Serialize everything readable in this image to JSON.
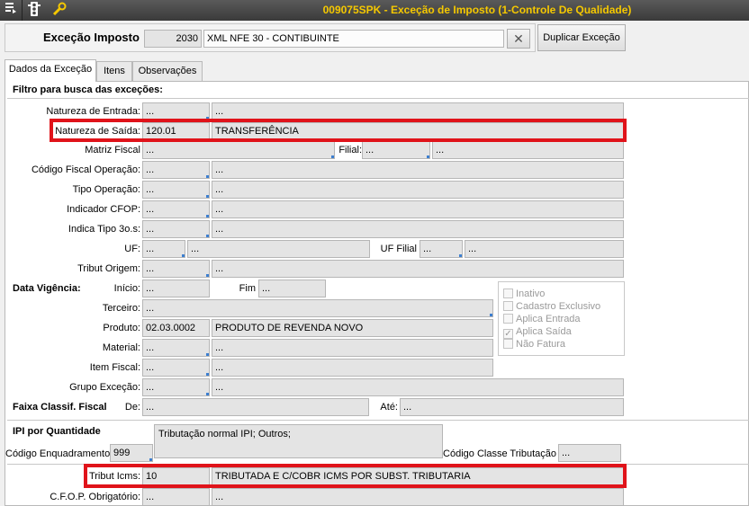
{
  "window": {
    "title": "009075SPK - Exceção de Imposto (1-Controle De Qualidade)"
  },
  "toolbar": {
    "icons": [
      "menu-icon",
      "traffic-light-icon",
      "tools-icon"
    ]
  },
  "header": {
    "label": "Exceção Imposto",
    "code": "2030",
    "description": "XML NFE 30 - CONTIBUINTE",
    "clear_glyph": "✕",
    "duplicate_button": "Duplicar Exceção"
  },
  "tabs": [
    {
      "label": "Dados da Exceção",
      "active": true
    },
    {
      "label": "Itens",
      "active": false
    },
    {
      "label": "Observações",
      "active": false
    }
  ],
  "form": {
    "section_filter": "Filtro para busca das exceções:",
    "natureza_entrada": {
      "label": "Natureza de Entrada:",
      "code": "...",
      "desc": "..."
    },
    "natureza_saida": {
      "label": "Natureza de Saída:",
      "code": "120.01",
      "desc": "TRANSFERÊNCIA"
    },
    "matriz_fiscal": {
      "label": "Matriz Fiscal",
      "code": "...",
      "filial_label": "Filial:",
      "filial_code": "...",
      "filial_desc": "..."
    },
    "codigo_fiscal_operacao": {
      "label": "Código Fiscal Operação:",
      "code": "...",
      "desc": "..."
    },
    "tipo_operacao": {
      "label": "Tipo Operação:",
      "code": "...",
      "desc": "..."
    },
    "indicador_cfop": {
      "label": "Indicador CFOP:",
      "code": "...",
      "desc": "..."
    },
    "indica_tipo": {
      "label": "Indica Tipo 3o.s:",
      "code": "...",
      "desc": "..."
    },
    "uf": {
      "label": "UF:",
      "code": "...",
      "desc": "...",
      "filial_label": "UF Filial",
      "filial_code": "...",
      "filial_desc": "..."
    },
    "tribut_origem": {
      "label": "Tribut Origem:",
      "code": "...",
      "desc": "..."
    },
    "data_vigencia": {
      "label": "Data Vigência:",
      "inicio_label": "Início:",
      "inicio": "...",
      "fim_label": "Fim",
      "fim": "..."
    },
    "terceiro": {
      "label": "Terceiro:",
      "value": "..."
    },
    "produto": {
      "label": "Produto:",
      "code": "02.03.0002",
      "desc": "PRODUTO DE REVENDA NOVO"
    },
    "material": {
      "label": "Material:",
      "code": "...",
      "desc": "..."
    },
    "item_fiscal": {
      "label": "Item Fiscal:",
      "code": "...",
      "desc": "..."
    },
    "grupo_excecao": {
      "label": "Grupo Exceção:",
      "code": "...",
      "desc": "..."
    },
    "faixa": {
      "label": "Faixa Classif. Fiscal",
      "de_label": "De:",
      "de": "...",
      "ate_label": "Até:",
      "ate": "..."
    },
    "checks": [
      {
        "label": "Inativo",
        "checked": false
      },
      {
        "label": "Cadastro Exclusivo",
        "checked": false
      },
      {
        "label": "Aplica Entrada",
        "checked": false
      },
      {
        "label": "Aplica Saída",
        "checked": true
      },
      {
        "label": "Não Fatura",
        "checked": false
      }
    ],
    "ipi": {
      "section": "IPI por Quantidade",
      "enq_label": "Código Enquadramento",
      "enq_value": "999",
      "tributacao_text": "Tributação normal IPI; Outros;",
      "classe_label": "Código Classe Tributação",
      "classe_value": "..."
    },
    "tribut_icms": {
      "label": "Tribut Icms:",
      "code": "10",
      "desc": "TRIBUTADA E C/COBR ICMS POR SUBST. TRIBUTARIA"
    },
    "cfop_obrig": {
      "label": "C.F.O.P. Obrigatório:",
      "code": "...",
      "desc": "..."
    }
  },
  "colors": {
    "highlight": "#e0131a",
    "title_text": "#f5c800",
    "lookup_marker": "#3d7fd0"
  }
}
